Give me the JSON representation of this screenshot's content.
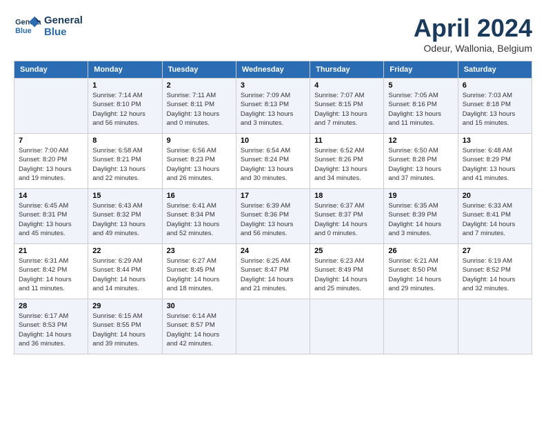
{
  "header": {
    "logo_line1": "General",
    "logo_line2": "Blue",
    "month": "April 2024",
    "location": "Odeur, Wallonia, Belgium"
  },
  "days_of_week": [
    "Sunday",
    "Monday",
    "Tuesday",
    "Wednesday",
    "Thursday",
    "Friday",
    "Saturday"
  ],
  "weeks": [
    [
      {
        "day": "",
        "empty": true
      },
      {
        "day": "1",
        "sunrise": "7:14 AM",
        "sunset": "8:10 PM",
        "daylight": "12 hours and 56 minutes."
      },
      {
        "day": "2",
        "sunrise": "7:11 AM",
        "sunset": "8:11 PM",
        "daylight": "13 hours and 0 minutes."
      },
      {
        "day": "3",
        "sunrise": "7:09 AM",
        "sunset": "8:13 PM",
        "daylight": "13 hours and 3 minutes."
      },
      {
        "day": "4",
        "sunrise": "7:07 AM",
        "sunset": "8:15 PM",
        "daylight": "13 hours and 7 minutes."
      },
      {
        "day": "5",
        "sunrise": "7:05 AM",
        "sunset": "8:16 PM",
        "daylight": "13 hours and 11 minutes."
      },
      {
        "day": "6",
        "sunrise": "7:03 AM",
        "sunset": "8:18 PM",
        "daylight": "13 hours and 15 minutes."
      }
    ],
    [
      {
        "day": "7",
        "sunrise": "7:00 AM",
        "sunset": "8:20 PM",
        "daylight": "13 hours and 19 minutes."
      },
      {
        "day": "8",
        "sunrise": "6:58 AM",
        "sunset": "8:21 PM",
        "daylight": "13 hours and 22 minutes."
      },
      {
        "day": "9",
        "sunrise": "6:56 AM",
        "sunset": "8:23 PM",
        "daylight": "13 hours and 26 minutes."
      },
      {
        "day": "10",
        "sunrise": "6:54 AM",
        "sunset": "8:24 PM",
        "daylight": "13 hours and 30 minutes."
      },
      {
        "day": "11",
        "sunrise": "6:52 AM",
        "sunset": "8:26 PM",
        "daylight": "13 hours and 34 minutes."
      },
      {
        "day": "12",
        "sunrise": "6:50 AM",
        "sunset": "8:28 PM",
        "daylight": "13 hours and 37 minutes."
      },
      {
        "day": "13",
        "sunrise": "6:48 AM",
        "sunset": "8:29 PM",
        "daylight": "13 hours and 41 minutes."
      }
    ],
    [
      {
        "day": "14",
        "sunrise": "6:45 AM",
        "sunset": "8:31 PM",
        "daylight": "13 hours and 45 minutes."
      },
      {
        "day": "15",
        "sunrise": "6:43 AM",
        "sunset": "8:32 PM",
        "daylight": "13 hours and 49 minutes."
      },
      {
        "day": "16",
        "sunrise": "6:41 AM",
        "sunset": "8:34 PM",
        "daylight": "13 hours and 52 minutes."
      },
      {
        "day": "17",
        "sunrise": "6:39 AM",
        "sunset": "8:36 PM",
        "daylight": "13 hours and 56 minutes."
      },
      {
        "day": "18",
        "sunrise": "6:37 AM",
        "sunset": "8:37 PM",
        "daylight": "14 hours and 0 minutes."
      },
      {
        "day": "19",
        "sunrise": "6:35 AM",
        "sunset": "8:39 PM",
        "daylight": "14 hours and 3 minutes."
      },
      {
        "day": "20",
        "sunrise": "6:33 AM",
        "sunset": "8:41 PM",
        "daylight": "14 hours and 7 minutes."
      }
    ],
    [
      {
        "day": "21",
        "sunrise": "6:31 AM",
        "sunset": "8:42 PM",
        "daylight": "14 hours and 11 minutes."
      },
      {
        "day": "22",
        "sunrise": "6:29 AM",
        "sunset": "8:44 PM",
        "daylight": "14 hours and 14 minutes."
      },
      {
        "day": "23",
        "sunrise": "6:27 AM",
        "sunset": "8:45 PM",
        "daylight": "14 hours and 18 minutes."
      },
      {
        "day": "24",
        "sunrise": "6:25 AM",
        "sunset": "8:47 PM",
        "daylight": "14 hours and 21 minutes."
      },
      {
        "day": "25",
        "sunrise": "6:23 AM",
        "sunset": "8:49 PM",
        "daylight": "14 hours and 25 minutes."
      },
      {
        "day": "26",
        "sunrise": "6:21 AM",
        "sunset": "8:50 PM",
        "daylight": "14 hours and 29 minutes."
      },
      {
        "day": "27",
        "sunrise": "6:19 AM",
        "sunset": "8:52 PM",
        "daylight": "14 hours and 32 minutes."
      }
    ],
    [
      {
        "day": "28",
        "sunrise": "6:17 AM",
        "sunset": "8:53 PM",
        "daylight": "14 hours and 36 minutes."
      },
      {
        "day": "29",
        "sunrise": "6:15 AM",
        "sunset": "8:55 PM",
        "daylight": "14 hours and 39 minutes."
      },
      {
        "day": "30",
        "sunrise": "6:14 AM",
        "sunset": "8:57 PM",
        "daylight": "14 hours and 42 minutes."
      },
      {
        "day": "",
        "empty": true
      },
      {
        "day": "",
        "empty": true
      },
      {
        "day": "",
        "empty": true
      },
      {
        "day": "",
        "empty": true
      }
    ]
  ],
  "labels": {
    "sunrise": "Sunrise:",
    "sunset": "Sunset:",
    "daylight": "Daylight:"
  }
}
